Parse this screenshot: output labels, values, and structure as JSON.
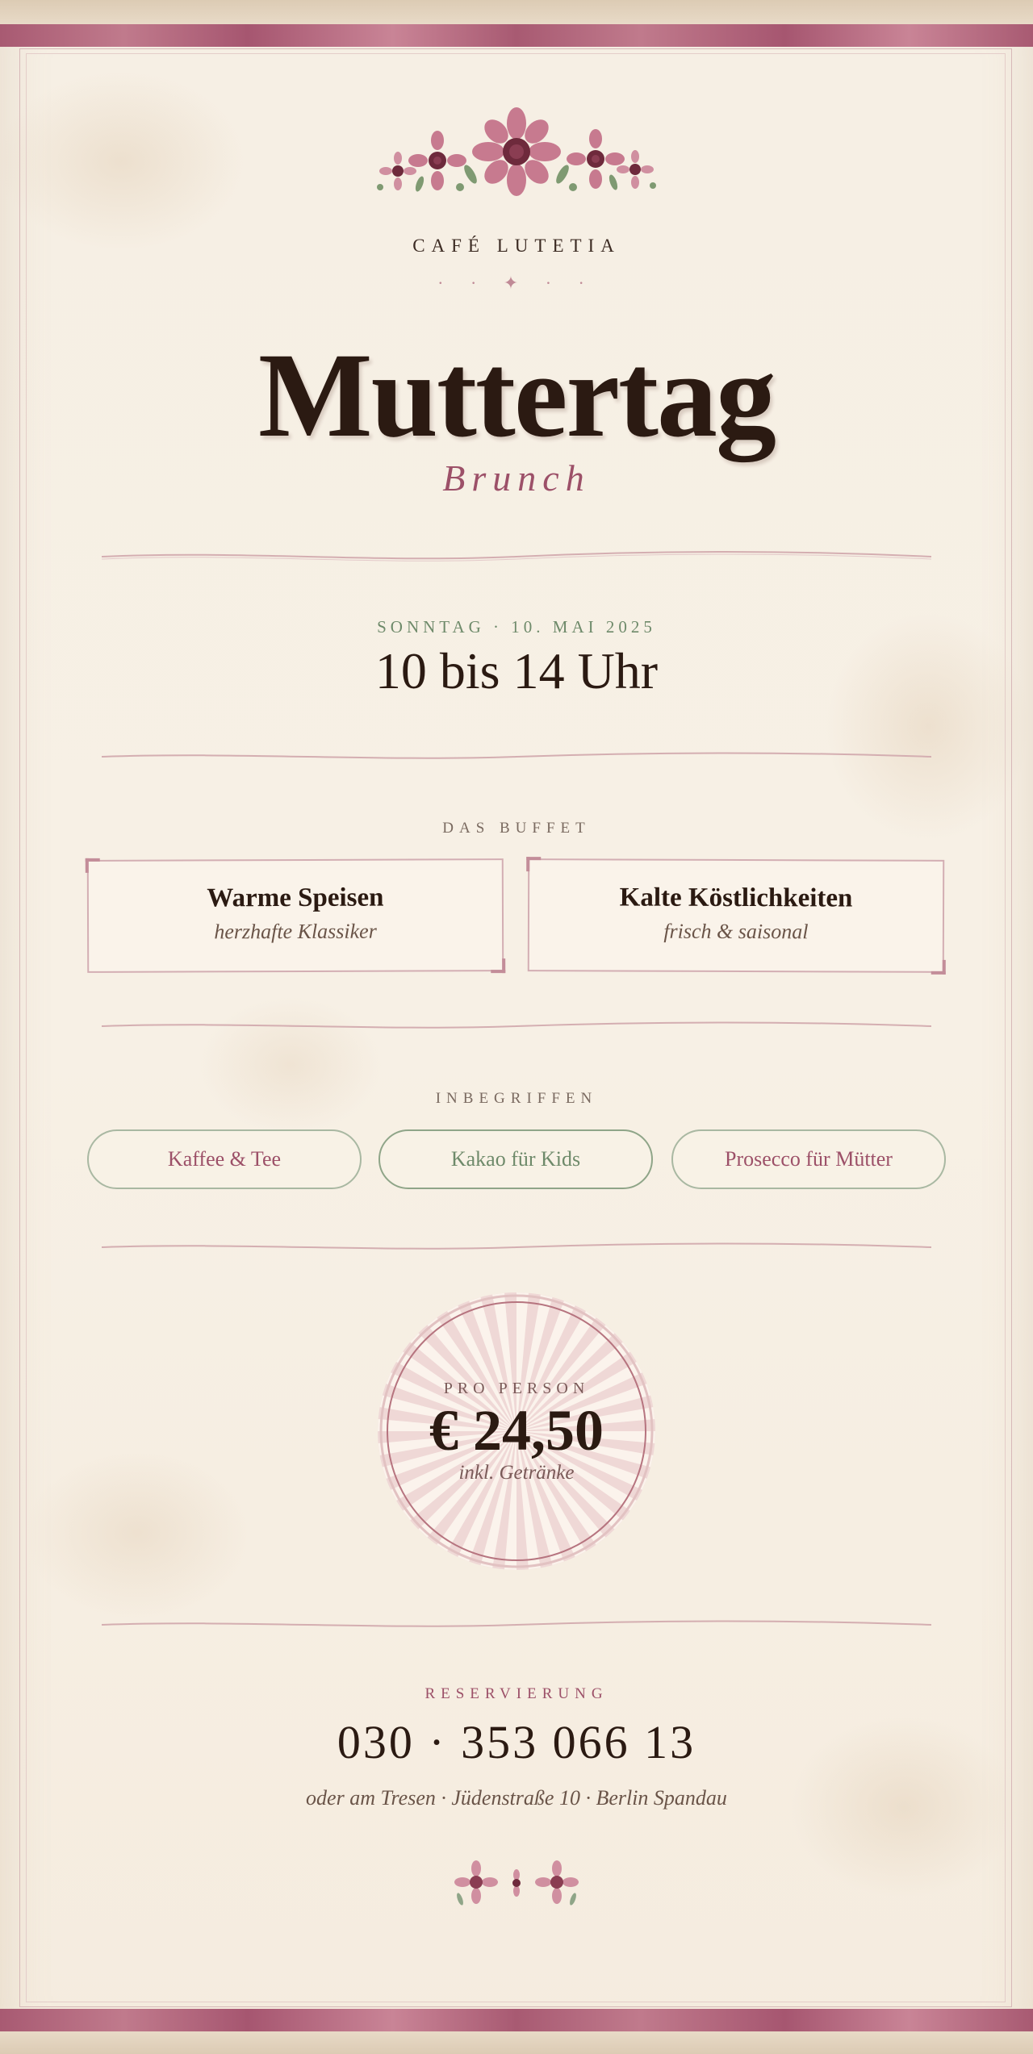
{
  "brand": {
    "name": "CAFÉ LUTETIA",
    "ornament": "· · ✦ · ·"
  },
  "hero": {
    "title": "Muttertag",
    "subtitle": "Brunch"
  },
  "event": {
    "date": "SONNTAG · 10. MAI 2025",
    "time": "10 bis 14 Uhr"
  },
  "buffet": {
    "label": "DAS BUFFET",
    "cards": [
      {
        "title": "Warme Speisen",
        "subtitle": "herzhafte Klassiker"
      },
      {
        "title": "Kalte Köstlichkeiten",
        "subtitle": "frisch & saisonal"
      }
    ]
  },
  "included": {
    "label": "INBEGRIFFEN",
    "items": [
      "Kaffee & Tee",
      "Kakao für Kids",
      "Prosecco für Mütter"
    ]
  },
  "price": {
    "label": "PRO PERSON",
    "amount": "€ 24,50",
    "note": "inkl. Getränke"
  },
  "reservation": {
    "label": "RESERVIERUNG",
    "phone": "030 · 353 066 13",
    "address": "oder am Tresen · Jüdenstraße 10 · Berlin Spandau"
  },
  "colors": {
    "accent_rose": "#9c5068",
    "sage": "#6e8a6a",
    "ink": "#2b1a12",
    "paper": "#f6efe4",
    "band": "#a85a72"
  },
  "icons": [
    "flower-garland-icon",
    "small-flower-garland-icon",
    "sunburst-badge-icon"
  ]
}
